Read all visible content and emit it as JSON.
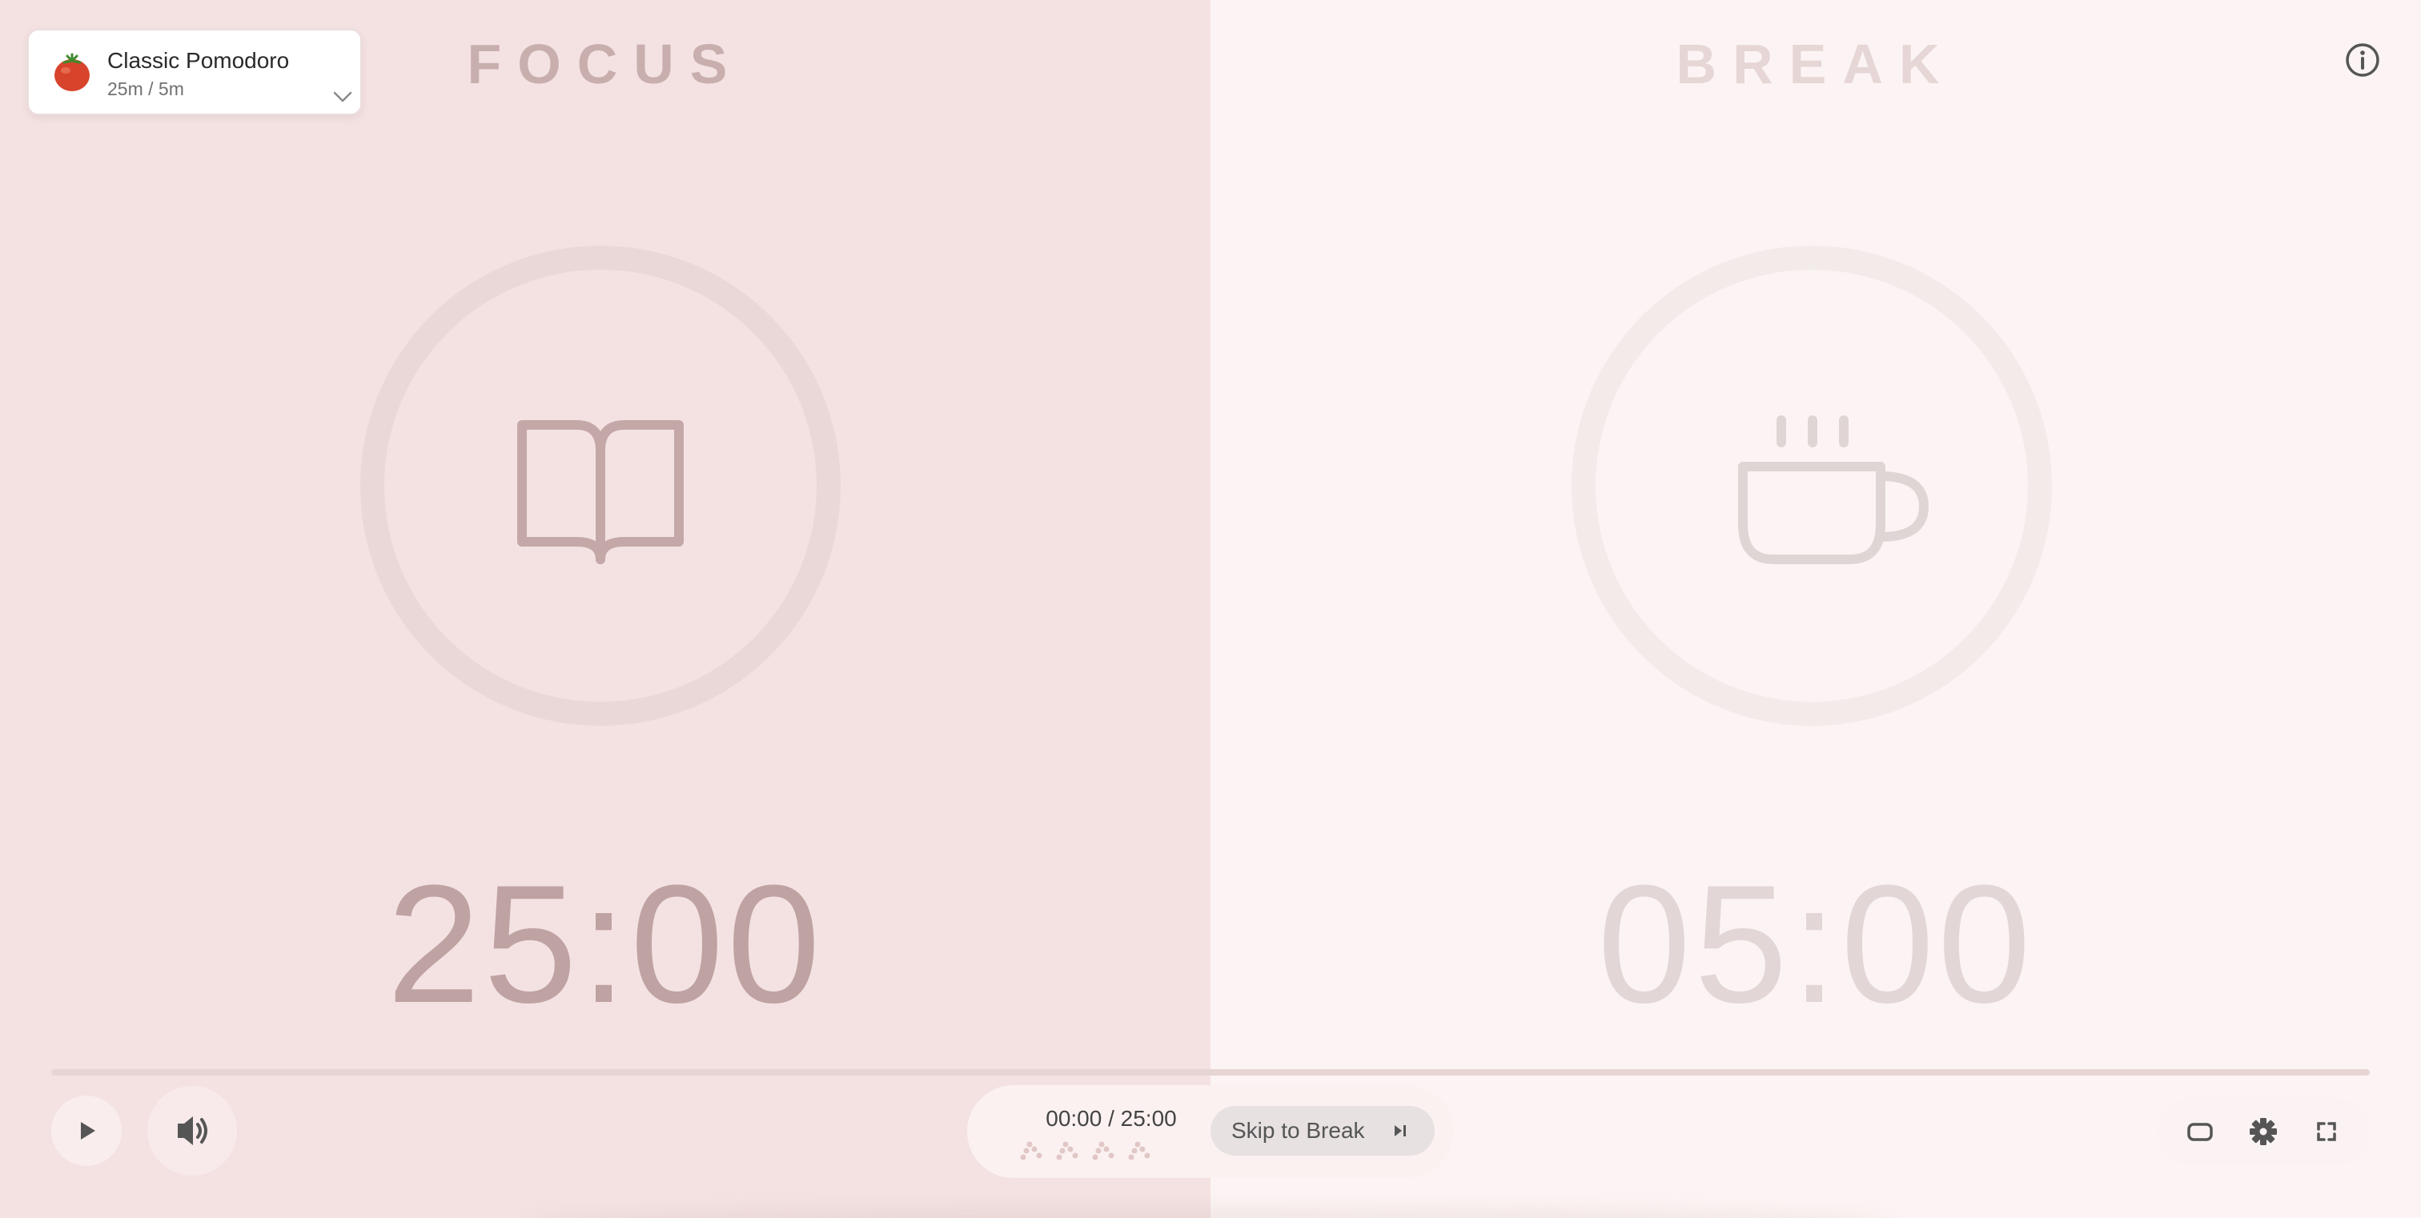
{
  "preset": {
    "name": "Classic Pomodoro",
    "subtitle": "25m / 5m",
    "icon": "tomato-icon"
  },
  "focus": {
    "title": "FOCUS",
    "time": "25:00",
    "icon": "book-icon"
  },
  "break": {
    "title": "BREAK",
    "time": "05:00",
    "icon": "coffee-cup-icon"
  },
  "progress": {
    "fraction": 0
  },
  "controls": {
    "play_icon": "play-icon",
    "volume_icon": "volume-icon",
    "time_readout": "00:00 / 25:00",
    "cycle_dots_count": 4,
    "skip_label": "Skip to Break",
    "skip_icon": "skip-next-icon"
  },
  "toolbar": {
    "icons": [
      "mini-window-icon",
      "gear-icon",
      "fullscreen-icon",
      "info-icon"
    ]
  },
  "colors": {
    "focus_bg": "#f4e2e2",
    "break_bg": "#fcf4f4",
    "focus_accent": "#bfa2a2",
    "break_accent": "#e3d6d6"
  }
}
